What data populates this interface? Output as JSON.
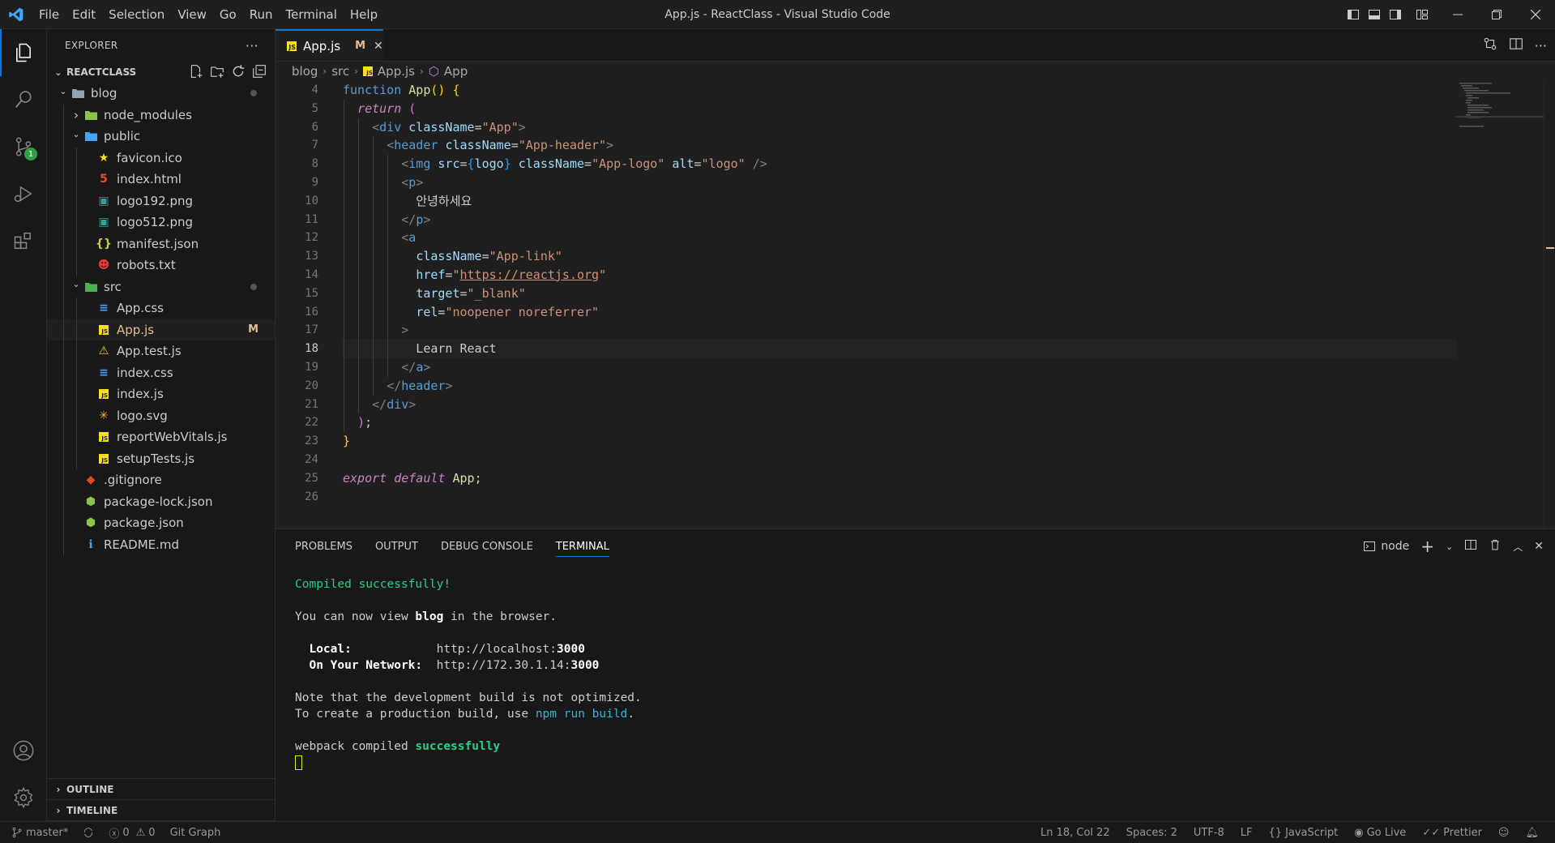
{
  "window": {
    "title": "App.js - ReactClass - Visual Studio Code"
  },
  "menu": [
    "File",
    "Edit",
    "Selection",
    "View",
    "Go",
    "Run",
    "Terminal",
    "Help"
  ],
  "sidebar": {
    "header": "EXPLORER",
    "workspace": "REACTCLASS",
    "tree": [
      {
        "label": "blog",
        "depth": 0,
        "type": "folder-open",
        "dot": true
      },
      {
        "label": "node_modules",
        "depth": 1,
        "type": "folder-closed"
      },
      {
        "label": "public",
        "depth": 1,
        "type": "folder-open"
      },
      {
        "label": "favicon.ico",
        "depth": 2,
        "type": "file",
        "icon": "★",
        "iconColor": "#f7df1e"
      },
      {
        "label": "index.html",
        "depth": 2,
        "type": "file",
        "icon": "5",
        "iconColor": "#e44d26"
      },
      {
        "label": "logo192.png",
        "depth": 2,
        "type": "file",
        "icon": "▣",
        "iconColor": "#26a69a"
      },
      {
        "label": "logo512.png",
        "depth": 2,
        "type": "file",
        "icon": "▣",
        "iconColor": "#26a69a"
      },
      {
        "label": "manifest.json",
        "depth": 2,
        "type": "file",
        "icon": "{}",
        "iconColor": "#cbcb41"
      },
      {
        "label": "robots.txt",
        "depth": 2,
        "type": "file",
        "icon": "☻",
        "iconColor": "#e53935"
      },
      {
        "label": "src",
        "depth": 1,
        "type": "folder-open",
        "dot": true
      },
      {
        "label": "App.css",
        "depth": 2,
        "type": "file",
        "icon": "≡",
        "iconColor": "#42a5f5"
      },
      {
        "label": "App.js",
        "depth": 2,
        "type": "file",
        "icon": "JS",
        "iconColor": "#f7df1e",
        "selected": true,
        "mod": "M"
      },
      {
        "label": "App.test.js",
        "depth": 2,
        "type": "file",
        "icon": "⚠",
        "iconColor": "#ffca28"
      },
      {
        "label": "index.css",
        "depth": 2,
        "type": "file",
        "icon": "≡",
        "iconColor": "#42a5f5"
      },
      {
        "label": "index.js",
        "depth": 2,
        "type": "file",
        "icon": "JS",
        "iconColor": "#f7df1e"
      },
      {
        "label": "logo.svg",
        "depth": 2,
        "type": "file",
        "icon": "✳",
        "iconColor": "#ffb13b"
      },
      {
        "label": "reportWebVitals.js",
        "depth": 2,
        "type": "file",
        "icon": "JS",
        "iconColor": "#f7df1e"
      },
      {
        "label": "setupTests.js",
        "depth": 2,
        "type": "file",
        "icon": "JS",
        "iconColor": "#f7df1e"
      },
      {
        "label": ".gitignore",
        "depth": 1,
        "type": "file",
        "icon": "◆",
        "iconColor": "#e64a19"
      },
      {
        "label": "package-lock.json",
        "depth": 1,
        "type": "file",
        "icon": "⬢",
        "iconColor": "#8bc34a"
      },
      {
        "label": "package.json",
        "depth": 1,
        "type": "file",
        "icon": "⬢",
        "iconColor": "#8bc34a"
      },
      {
        "label": "README.md",
        "depth": 1,
        "type": "file",
        "icon": "ℹ",
        "iconColor": "#42a5f5"
      }
    ],
    "outline": "OUTLINE",
    "timeline": "TIMELINE"
  },
  "editor": {
    "tab": {
      "label": "App.js",
      "mod": "M"
    },
    "breadcrumb": [
      "blog",
      "src",
      "App.js",
      "App"
    ],
    "current_line": 18,
    "lines": [
      {
        "n": 4,
        "html": "<span class='kw'>function</span> <span class='fn'>App</span><span class='br1'>()</span> <span class='br1'>{</span>"
      },
      {
        "n": 5,
        "html": "  <span class='kw2'>return</span> <span class='br2'>(</span>"
      },
      {
        "n": 6,
        "html": "    <span class='tagp'>&lt;</span><span class='tag'>div</span> <span class='attr'>className</span>=<span class='str'>\"App\"</span><span class='tagp'>&gt;</span>"
      },
      {
        "n": 7,
        "html": "      <span class='tagp'>&lt;</span><span class='tag'>header</span> <span class='attr'>className</span>=<span class='str'>\"App-header\"</span><span class='tagp'>&gt;</span>"
      },
      {
        "n": 8,
        "html": "        <span class='tagp'>&lt;</span><span class='tag'>img</span> <span class='attr'>src</span>=<span class='br3'>{</span><span class='attr'>logo</span><span class='br3'>}</span> <span class='attr'>className</span>=<span class='str'>\"App-logo\"</span> <span class='attr'>alt</span>=<span class='str'>\"logo\"</span> <span class='tagp'>/&gt;</span>"
      },
      {
        "n": 9,
        "html": "        <span class='tagp'>&lt;</span><span class='tag'>p</span><span class='tagp'>&gt;</span>"
      },
      {
        "n": 10,
        "html": "          안녕하세요"
      },
      {
        "n": 11,
        "html": "        <span class='tagp'>&lt;/</span><span class='tag'>p</span><span class='tagp'>&gt;</span>"
      },
      {
        "n": 12,
        "html": "        <span class='tagp'>&lt;</span><span class='tag'>a</span>"
      },
      {
        "n": 13,
        "html": "          <span class='attr'>className</span>=<span class='str'>\"App-link\"</span>"
      },
      {
        "n": 14,
        "html": "          <span class='attr'>href</span>=<span class='str'>\"<span class='link'>https://reactjs.org</span>\"</span>"
      },
      {
        "n": 15,
        "html": "          <span class='attr'>target</span>=<span class='str'>\"_blank\"</span>"
      },
      {
        "n": 16,
        "html": "          <span class='attr'>rel</span>=<span class='str'>\"noopener noreferrer\"</span>"
      },
      {
        "n": 17,
        "html": "        <span class='tagp'>&gt;</span>"
      },
      {
        "n": 18,
        "html": "          Learn React"
      },
      {
        "n": 19,
        "html": "        <span class='tagp'>&lt;/</span><span class='tag'>a</span><span class='tagp'>&gt;</span>"
      },
      {
        "n": 20,
        "html": "      <span class='tagp'>&lt;/</span><span class='tag'>header</span><span class='tagp'>&gt;</span>"
      },
      {
        "n": 21,
        "html": "    <span class='tagp'>&lt;/</span><span class='tag'>div</span><span class='tagp'>&gt;</span>"
      },
      {
        "n": 22,
        "html": "  <span class='br2'>)</span>;"
      },
      {
        "n": 23,
        "html": "<span class='br1'>}</span>"
      },
      {
        "n": 24,
        "html": ""
      },
      {
        "n": 25,
        "html": "<span class='kw2'>export</span> <span class='kw2'>default</span> <span class='fn'>App</span>;"
      },
      {
        "n": 26,
        "html": ""
      }
    ]
  },
  "panel": {
    "tabs": [
      "PROBLEMS",
      "OUTPUT",
      "DEBUG CONSOLE",
      "TERMINAL"
    ],
    "active_tab": "TERMINAL",
    "terminal_name": "node",
    "terminal_lines": [
      {
        "html": "<span class='t-ok'>Compiled successfully!</span>"
      },
      {
        "html": ""
      },
      {
        "html": "You can now view <span class='t-bold'>blog</span> in the browser."
      },
      {
        "html": ""
      },
      {
        "html": "  <span class='t-bold'>Local:</span>            http://localhost:<span class='t-bold'>3000</span>"
      },
      {
        "html": "  <span class='t-bold'>On Your Network:</span>  http://172.30.1.14:<span class='t-bold'>3000</span>"
      },
      {
        "html": ""
      },
      {
        "html": "Note that the development build is not optimized."
      },
      {
        "html": "To create a production build, use <span class='t-cyan'>npm run build</span>."
      },
      {
        "html": ""
      },
      {
        "html": "webpack compiled <span class='t-ok' style='font-weight:bold'>successfully</span>"
      },
      {
        "html": "<span class='cursor-box'></span>"
      }
    ]
  },
  "statusbar": {
    "branch": "master*",
    "errors": "0",
    "warnings": "0",
    "git_graph": "Git Graph",
    "position": "Ln 18, Col 22",
    "spaces": "Spaces: 2",
    "encoding": "UTF-8",
    "eol": "LF",
    "language": "JavaScript",
    "go_live": "Go Live",
    "prettier": "Prettier"
  },
  "badges": {
    "scm_count": "1"
  }
}
